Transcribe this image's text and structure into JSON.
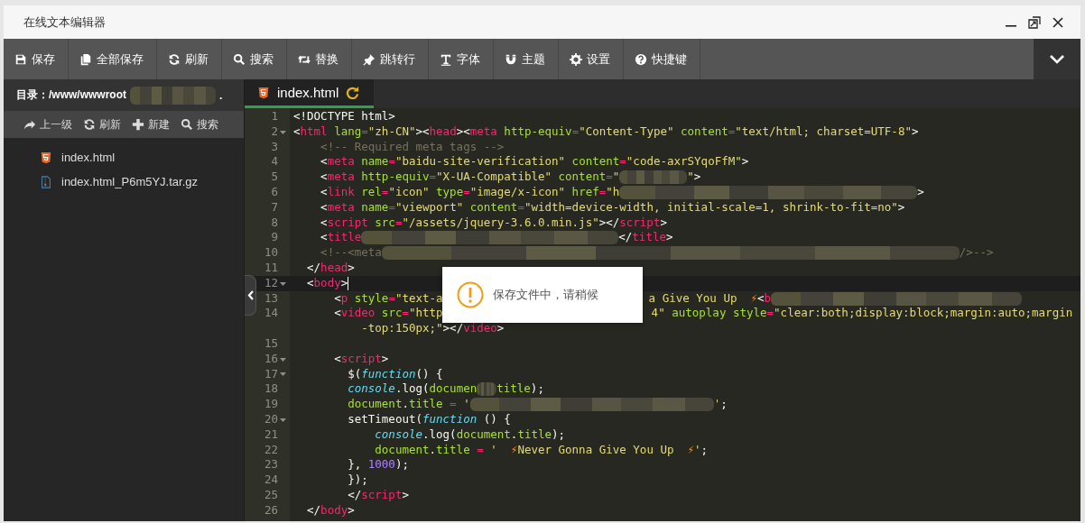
{
  "window": {
    "title": "在线文本编辑器"
  },
  "toolbar": [
    {
      "label": "保存",
      "kind": "save"
    },
    {
      "label": "全部保存",
      "kind": "saveall"
    },
    {
      "label": "刷新",
      "kind": "refresh"
    },
    {
      "label": "搜索",
      "kind": "search"
    },
    {
      "label": "替换",
      "kind": "replace"
    },
    {
      "label": "跳转行",
      "kind": "goto"
    },
    {
      "label": "字体",
      "kind": "font"
    },
    {
      "label": "主题",
      "kind": "theme"
    },
    {
      "label": "设置",
      "kind": "settings"
    },
    {
      "label": "快捷键",
      "kind": "help"
    }
  ],
  "sidebar": {
    "path": "目录：/www/wwwroot",
    "path_tail": ".",
    "actions": [
      {
        "label": "上一级",
        "kind": "up"
      },
      {
        "label": "刷新",
        "kind": "refresh"
      },
      {
        "label": "新建",
        "kind": "new"
      },
      {
        "label": "搜索",
        "kind": "search"
      }
    ],
    "files": [
      {
        "name": "index.html",
        "kind": "html"
      },
      {
        "name": "index.html_P6m5YJ.tar.gz",
        "kind": "archive"
      }
    ]
  },
  "tabs": [
    {
      "label": "index.html",
      "selected": true
    }
  ],
  "code": {
    "lines": [
      {
        "number": "1",
        "fold": false,
        "active": false,
        "tokens": [
          {
            "kind": "p",
            "text": "<!DOCTYPE html>"
          }
        ]
      },
      {
        "number": "2",
        "fold": true,
        "active": false,
        "tokens": [
          {
            "kind": "p",
            "text": "<"
          },
          {
            "kind": "tag",
            "text": "html"
          },
          {
            "kind": "attr",
            "text": " lang"
          },
          {
            "kind": "tag",
            "text": "="
          },
          {
            "kind": "str",
            "text": "\"zh-CN\""
          },
          {
            "kind": "p",
            "text": "><"
          },
          {
            "kind": "tag",
            "text": "head"
          },
          {
            "kind": "p",
            "text": "><"
          },
          {
            "kind": "tag",
            "text": "meta"
          },
          {
            "kind": "attr",
            "text": " http-equiv"
          },
          {
            "kind": "tag",
            "text": "="
          },
          {
            "kind": "str",
            "text": "\"Content-Type\""
          },
          {
            "kind": "attr",
            "text": " content"
          },
          {
            "kind": "tag",
            "text": "="
          },
          {
            "kind": "str",
            "text": "\"text/html; charset=UTF-8\""
          },
          {
            "kind": "p",
            "text": ">"
          }
        ]
      },
      {
        "number": "3",
        "fold": false,
        "active": false,
        "tokens": [
          {
            "kind": "cm",
            "text": "    <!-- Required meta tags -->"
          }
        ]
      },
      {
        "number": "4",
        "fold": false,
        "active": false,
        "tokens": [
          {
            "kind": "p",
            "text": "    <"
          },
          {
            "kind": "tag",
            "text": "meta"
          },
          {
            "kind": "attr",
            "text": " name"
          },
          {
            "kind": "tag",
            "text": "="
          },
          {
            "kind": "str",
            "text": "\"baidu-site-verification\""
          },
          {
            "kind": "attr",
            "text": " content"
          },
          {
            "kind": "tag",
            "text": "="
          },
          {
            "kind": "str",
            "text": "\"code-axrSYqoFfM\""
          },
          {
            "kind": "p",
            "text": ">"
          }
        ]
      },
      {
        "number": "5",
        "fold": false,
        "active": false,
        "tokens": [
          {
            "kind": "p",
            "text": "    <"
          },
          {
            "kind": "tag",
            "text": "meta"
          },
          {
            "kind": "attr",
            "text": " http-equiv"
          },
          {
            "kind": "tag",
            "text": "="
          },
          {
            "kind": "str",
            "text": "\"X-UA-Compatible\""
          },
          {
            "kind": "attr",
            "text": " content"
          },
          {
            "kind": "tag",
            "text": "="
          },
          {
            "kind": "str",
            "text": "\""
          },
          {
            "kind": "blur"
          },
          {
            "kind": "str",
            "text": "\""
          },
          {
            "kind": "p",
            "text": ">"
          }
        ]
      },
      {
        "number": "6",
        "fold": false,
        "active": false,
        "tokens": [
          {
            "kind": "p",
            "text": "    <"
          },
          {
            "kind": "tag",
            "text": "link"
          },
          {
            "kind": "attr",
            "text": " rel"
          },
          {
            "kind": "tag",
            "text": "="
          },
          {
            "kind": "str",
            "text": "\"icon\""
          },
          {
            "kind": "attr",
            "text": " type"
          },
          {
            "kind": "tag",
            "text": "="
          },
          {
            "kind": "str",
            "text": "\"image/x-icon\""
          },
          {
            "kind": "attr",
            "text": " href"
          },
          {
            "kind": "tag",
            "text": "="
          },
          {
            "kind": "str",
            "text": "\"h"
          },
          {
            "kind": "blur"
          },
          {
            "kind": "p",
            "text": ">"
          }
        ]
      },
      {
        "number": "7",
        "fold": false,
        "active": false,
        "tokens": [
          {
            "kind": "p",
            "text": "    <"
          },
          {
            "kind": "tag",
            "text": "meta"
          },
          {
            "kind": "attr",
            "text": " name"
          },
          {
            "kind": "tag",
            "text": "="
          },
          {
            "kind": "str",
            "text": "\"viewport\""
          },
          {
            "kind": "attr",
            "text": " content"
          },
          {
            "kind": "tag",
            "text": "="
          },
          {
            "kind": "str",
            "text": "\"width=device-width, initial-scale=1, shrink-to-fit=no\""
          },
          {
            "kind": "p",
            "text": ">"
          }
        ]
      },
      {
        "number": "8",
        "fold": false,
        "active": false,
        "tokens": [
          {
            "kind": "p",
            "text": "    <"
          },
          {
            "kind": "tag",
            "text": "script"
          },
          {
            "kind": "attr",
            "text": " src"
          },
          {
            "kind": "tag",
            "text": "="
          },
          {
            "kind": "str",
            "text": "\"/assets/jquery-3.6.0.min.js\""
          },
          {
            "kind": "p",
            "text": "></"
          },
          {
            "kind": "tag",
            "text": "script"
          },
          {
            "kind": "p",
            "text": ">"
          }
        ]
      },
      {
        "number": "9",
        "fold": false,
        "active": false,
        "tokens": [
          {
            "kind": "p",
            "text": "    <"
          },
          {
            "kind": "tag",
            "text": "title"
          },
          {
            "kind": "blur"
          },
          {
            "kind": "p",
            "text": "</"
          },
          {
            "kind": "tag",
            "text": "title"
          },
          {
            "kind": "p",
            "text": ">"
          }
        ]
      },
      {
        "number": "10",
        "fold": false,
        "active": false,
        "tokens": [
          {
            "kind": "cm",
            "text": "    <!--<meta"
          },
          {
            "kind": "blur"
          },
          {
            "kind": "cm",
            "text": "/>-->"
          }
        ]
      },
      {
        "number": "11",
        "fold": false,
        "active": false,
        "tokens": [
          {
            "kind": "p",
            "text": "  </"
          },
          {
            "kind": "tag",
            "text": "head"
          },
          {
            "kind": "p",
            "text": ">"
          }
        ]
      },
      {
        "number": "12",
        "fold": true,
        "active": true,
        "tokens": [
          {
            "kind": "p",
            "text": "  <"
          },
          {
            "kind": "tag",
            "text": "body"
          },
          {
            "kind": "p",
            "text": ">"
          }
        ]
      },
      {
        "number": "13",
        "fold": false,
        "active": false,
        "tokens": [
          {
            "kind": "p",
            "text": "      <"
          },
          {
            "kind": "tag",
            "text": "p"
          },
          {
            "kind": "attr",
            "text": " style"
          },
          {
            "kind": "tag",
            "text": "="
          },
          {
            "kind": "str",
            "text": "\"text-a"
          },
          {
            "kind": "gap"
          },
          {
            "kind": "str",
            "text": "a Give You Up  "
          },
          {
            "kind": "bolt",
            "text": "⚡"
          },
          {
            "kind": "p",
            "text": "<"
          },
          {
            "kind": "tag",
            "text": "b"
          },
          {
            "kind": "blur"
          }
        ]
      },
      {
        "number": "14",
        "fold": false,
        "active": false,
        "tokens": [
          {
            "kind": "p",
            "text": "      <"
          },
          {
            "kind": "tag",
            "text": "video"
          },
          {
            "kind": "attr",
            "text": " src"
          },
          {
            "kind": "tag",
            "text": "="
          },
          {
            "kind": "str",
            "text": "\"http"
          },
          {
            "kind": "gap"
          },
          {
            "kind": "str",
            "text": "4\""
          },
          {
            "kind": "attr",
            "text": " autoplay style"
          },
          {
            "kind": "tag",
            "text": "="
          },
          {
            "kind": "str",
            "text": "\"clear:both;display:block;margin:auto;margin"
          }
        ]
      },
      {
        "fold": false,
        "active": false,
        "tokens": [
          {
            "kind": "str",
            "text": "          -top:150px;\""
          },
          {
            "kind": "p",
            "text": "></"
          },
          {
            "kind": "tag",
            "text": "video"
          },
          {
            "kind": "p",
            "text": ">"
          }
        ]
      },
      {
        "number": "15",
        "fold": false,
        "active": false
      },
      {
        "number": "16",
        "fold": true,
        "active": false,
        "tokens": [
          {
            "kind": "p",
            "text": "      <"
          },
          {
            "kind": "tag",
            "text": "script"
          },
          {
            "kind": "p",
            "text": ">"
          }
        ]
      },
      {
        "number": "17",
        "fold": true,
        "active": false,
        "tokens": [
          {
            "kind": "p",
            "text": "        $("
          },
          {
            "kind": "fn",
            "text": "function"
          },
          {
            "kind": "p",
            "text": "() {"
          }
        ]
      },
      {
        "number": "18",
        "fold": false,
        "active": false,
        "tokens": [
          {
            "kind": "fn",
            "text": "        console"
          },
          {
            "kind": "p",
            "text": ".log("
          },
          {
            "kind": "attr",
            "text": "documen"
          },
          {
            "kind": "blur"
          },
          {
            "kind": "attr",
            "text": "title"
          },
          {
            "kind": "p",
            "text": ");"
          }
        ]
      },
      {
        "number": "19",
        "fold": false,
        "active": false,
        "tokens": [
          {
            "kind": "attr",
            "text": "        document"
          },
          {
            "kind": "p",
            "text": "."
          },
          {
            "kind": "attr",
            "text": "title"
          },
          {
            "kind": "tag",
            "text": " ="
          },
          {
            "kind": "str",
            "text": " '"
          },
          {
            "kind": "blur"
          },
          {
            "kind": "str",
            "text": "'"
          },
          {
            "kind": "p",
            "text": ";"
          }
        ]
      },
      {
        "number": "20",
        "fold": true,
        "active": false,
        "tokens": [
          {
            "kind": "p",
            "text": "        setTimeout("
          },
          {
            "kind": "fn",
            "text": "function"
          },
          {
            "kind": "p",
            "text": " () {"
          }
        ]
      },
      {
        "number": "21",
        "fold": false,
        "active": false,
        "tokens": [
          {
            "kind": "fn",
            "text": "            console"
          },
          {
            "kind": "p",
            "text": ".log("
          },
          {
            "kind": "attr",
            "text": "document"
          },
          {
            "kind": "p",
            "text": "."
          },
          {
            "kind": "attr",
            "text": "title"
          },
          {
            "kind": "p",
            "text": ");"
          }
        ]
      },
      {
        "number": "22",
        "fold": false,
        "active": false,
        "tokens": [
          {
            "kind": "attr",
            "text": "            document"
          },
          {
            "kind": "p",
            "text": "."
          },
          {
            "kind": "attr",
            "text": "title"
          },
          {
            "kind": "tag",
            "text": " ="
          },
          {
            "kind": "str",
            "text": " '  "
          },
          {
            "kind": "bolt",
            "text": "⚡"
          },
          {
            "kind": "str",
            "text": "Never Gonna Give You Up  "
          },
          {
            "kind": "bolt",
            "text": "⚡"
          },
          {
            "kind": "str",
            "text": "'"
          },
          {
            "kind": "p",
            "text": ";"
          }
        ]
      },
      {
        "number": "23",
        "fold": false,
        "active": false,
        "tokens": [
          {
            "kind": "p",
            "text": "        }, "
          },
          {
            "kind": "num",
            "text": "1000"
          },
          {
            "kind": "p",
            "text": ");"
          }
        ]
      },
      {
        "number": "24",
        "fold": false,
        "active": false,
        "tokens": [
          {
            "kind": "p",
            "text": "        });"
          }
        ]
      },
      {
        "number": "25",
        "fold": false,
        "active": false,
        "tokens": [
          {
            "kind": "p",
            "text": "        </"
          },
          {
            "kind": "tag",
            "text": "script"
          },
          {
            "kind": "p",
            "text": ">"
          }
        ]
      },
      {
        "number": "26",
        "fold": false,
        "active": false,
        "tokens": [
          {
            "kind": "p",
            "text": "  </"
          },
          {
            "kind": "tag",
            "text": "body"
          },
          {
            "kind": "p",
            "text": ">"
          }
        ]
      }
    ]
  },
  "toast": {
    "message": "保存文件中，请稍候"
  }
}
